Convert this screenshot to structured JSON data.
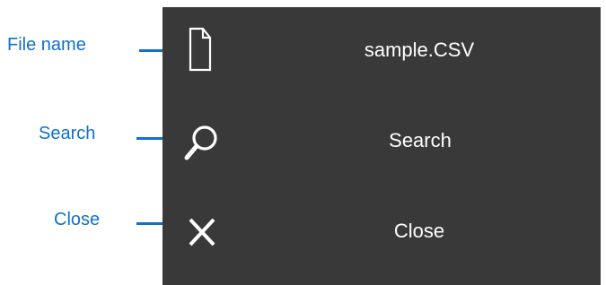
{
  "annotations": {
    "file_name": "File name",
    "search": "Search",
    "close": "Close"
  },
  "menu": {
    "file_label": "sample.CSV",
    "search_label": "Search",
    "close_label": "Close"
  },
  "icons": {
    "file": "file-icon",
    "search": "search-icon",
    "close": "close-icon"
  },
  "colors": {
    "annotation": "#1170c8",
    "panel_background": "#393939",
    "menu_text": "#ffffff"
  }
}
